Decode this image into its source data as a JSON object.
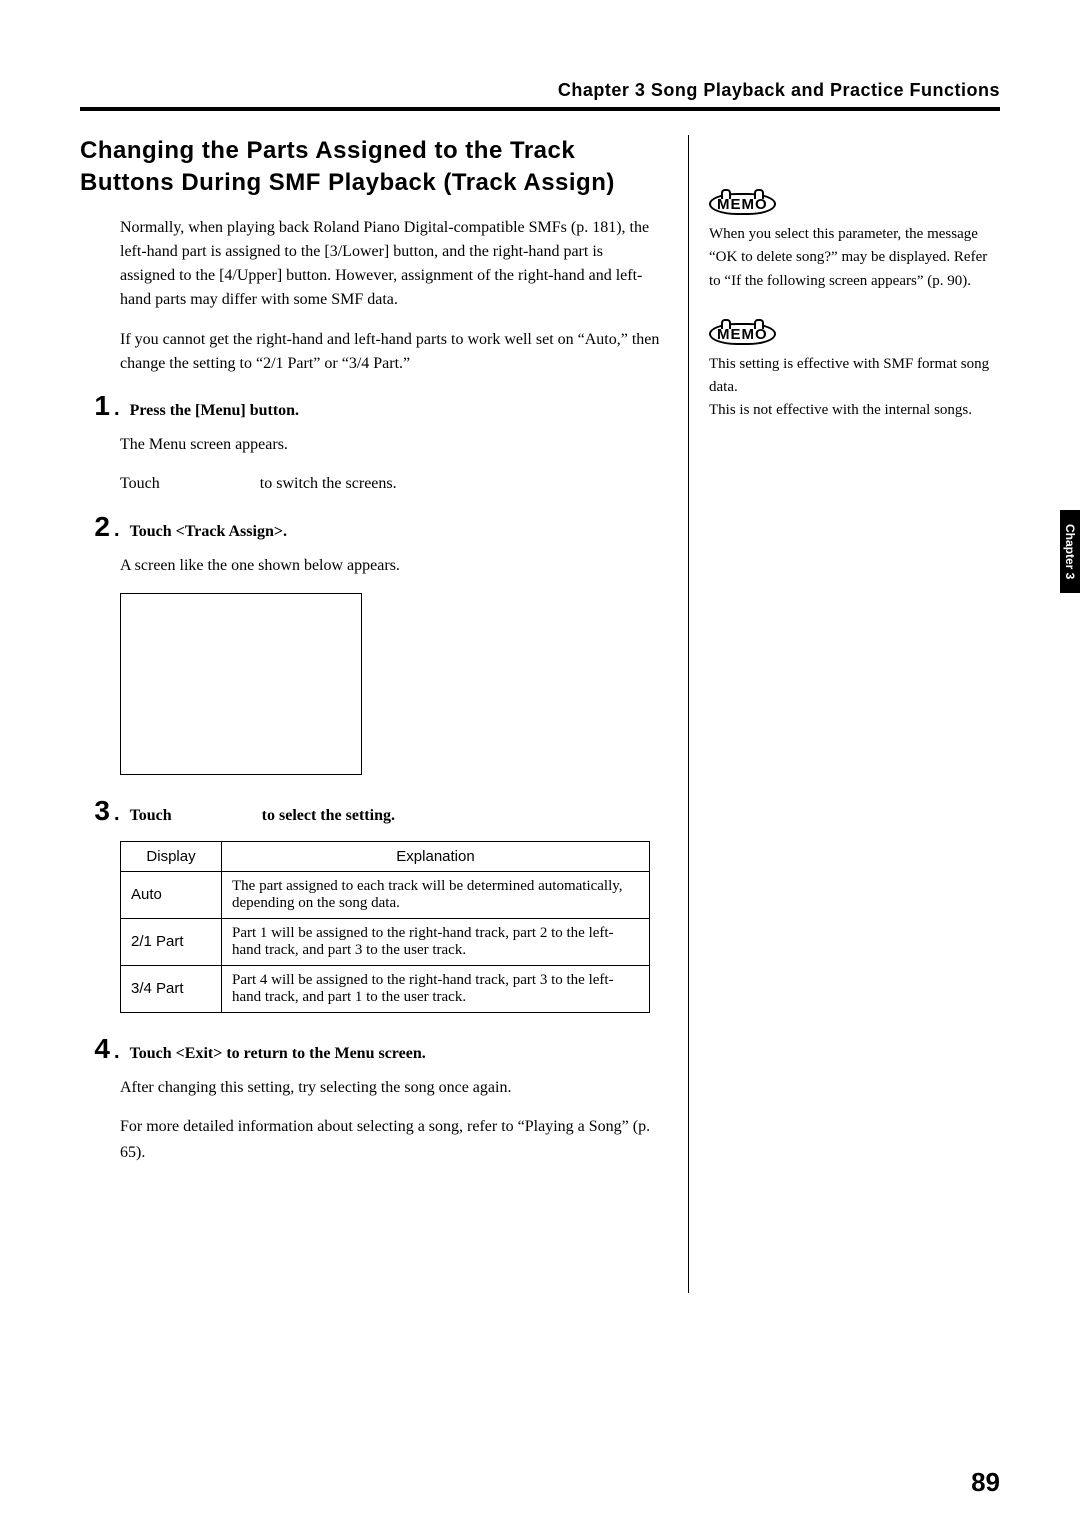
{
  "chapterHeader": "Chapter 3 Song Playback and Practice Functions",
  "sectionTitle": "Changing the Parts Assigned to the Track Buttons During SMF Playback (Track Assign)",
  "intro1": "Normally, when playing back Roland Piano Digital-compatible SMFs (p. 181), the left-hand part is assigned to the [3/Lower] button, and the right-hand part is assigned to the [4/Upper] button. However, assignment of the right-hand and left-hand parts may differ with some SMF data.",
  "intro2": "If you cannot get the right-hand and left-hand parts to work well set on “Auto,” then change the setting to “2/1 Part” or “3/4 Part.”",
  "steps": {
    "s1": {
      "num": "1",
      "label": "Press the [Menu] button.",
      "sub1": "The Menu screen appears.",
      "sub2a": "Touch",
      "sub2b": "to switch the screens."
    },
    "s2": {
      "num": "2",
      "label": "Touch <Track Assign>.",
      "sub1": "A screen like the one shown below appears."
    },
    "s3": {
      "num": "3",
      "labelA": "Touch",
      "labelB": "to select the setting."
    },
    "s4": {
      "num": "4",
      "label": "Touch <Exit> to return to the Menu screen.",
      "sub1": "After changing this setting, try selecting the song once again.",
      "sub2": "For more detailed information about selecting a song, refer to “Playing a Song” (p. 65)."
    }
  },
  "table": {
    "h1": "Display",
    "h2": "Explanation",
    "rows": [
      {
        "d": "Auto",
        "e": "The part assigned to each track will be determined automatically, depending on the song data."
      },
      {
        "d": "2/1 Part",
        "e": "Part 1 will be assigned to the right-hand track, part 2 to the left-hand track, and part 3 to the user track."
      },
      {
        "d": "3/4 Part",
        "e": "Part 4 will be assigned to the right-hand track, part 3 to the left-hand track, and part 1 to the user track."
      }
    ]
  },
  "memoLabel": "MEMO",
  "memo1": "When you select this parameter, the message “OK to delete song?” may be displayed. Refer to “If the following screen appears” (p. 90).",
  "memo2": "This setting is effective with SMF format song data.\nThis is not effective with the internal songs.",
  "sideTab": "Chapter 3",
  "pageNum": "89"
}
